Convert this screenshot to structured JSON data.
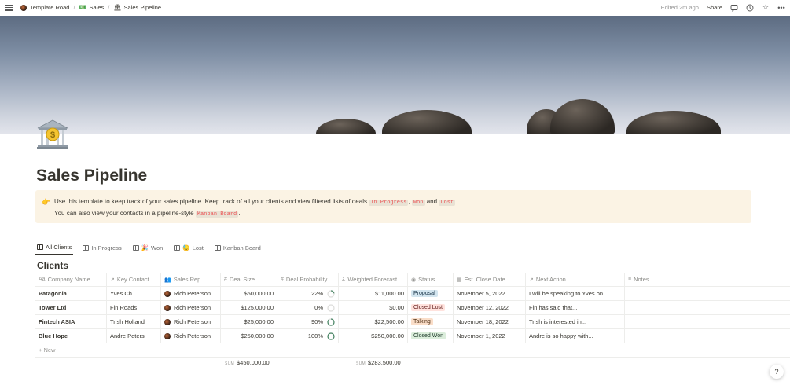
{
  "breadcrumb": [
    {
      "label": "Template Road",
      "icon": "avatar"
    },
    {
      "label": "Sales",
      "icon": "money-icon"
    },
    {
      "label": "Sales Pipeline",
      "icon": "bank-icon"
    }
  ],
  "topbar": {
    "edited": "Edited 2m ago",
    "share": "Share"
  },
  "page": {
    "title": "Sales Pipeline"
  },
  "callout": {
    "line1_a": "Use this template to keep track of your sales pipeline. Keep track of all your clients and view filtered lists of deals ",
    "tag_in_progress": "In Progress",
    "comma": ",",
    "tag_won": "Won",
    "and": " and ",
    "tag_lost": "Lost",
    "period": ".",
    "line2_a": "You can also view your contacts in a pipeline-style ",
    "tag_kanban": "Kanban Board",
    "line2_end": "."
  },
  "tabs": [
    {
      "label": "All Clients",
      "emoji": ""
    },
    {
      "label": "In Progress",
      "emoji": ""
    },
    {
      "label": "Won",
      "emoji": "🎉"
    },
    {
      "label": "Lost",
      "emoji": "😓"
    },
    {
      "label": "Kanban Board",
      "emoji": ""
    }
  ],
  "database": {
    "title": "Clients",
    "columns": [
      "Company Name",
      "Key Contact",
      "Sales Rep.",
      "Deal Size",
      "Deal Probability",
      "Weighted Forecast",
      "Status",
      "Est. Close Date",
      "Next Action",
      "Notes"
    ],
    "column_icons": [
      "Aa",
      "↗",
      "👥",
      "#",
      "#",
      "Σ",
      "◉",
      "▦",
      "↗",
      "≡"
    ],
    "rows": [
      {
        "company": "Patagonia",
        "contact": "Yves Ch.",
        "rep": "Rich Peterson",
        "deal": "$50,000.00",
        "prob": "22%",
        "prob_value": 0.22,
        "forecast": "$11,000.00",
        "status": "Proposal",
        "status_color": "#d3e5ef",
        "status_text_color": "#183347",
        "close": "November 5, 2022",
        "action": "I will be speaking to Yves on...",
        "notes": ""
      },
      {
        "company": "Tower Ltd",
        "contact": "Fin Roads",
        "rep": "Rich Peterson",
        "deal": "$125,000.00",
        "prob": "0%",
        "prob_value": 0,
        "forecast": "$0.00",
        "status": "Closed Lost",
        "status_color": "#ffe2dd",
        "status_text_color": "#5d1715",
        "close": "November 12, 2022",
        "action": "Fin has said that...",
        "notes": ""
      },
      {
        "company": "Fintech ASIA",
        "contact": "Trish Holland",
        "rep": "Rich Peterson",
        "deal": "$25,000.00",
        "prob": "90%",
        "prob_value": 0.9,
        "forecast": "$22,500.00",
        "status": "Talking",
        "status_color": "#fadec9",
        "status_text_color": "#49290e",
        "close": "November 18, 2022",
        "action": "Trish is interested in...",
        "notes": ""
      },
      {
        "company": "Blue Hope",
        "contact": "Andre Peters",
        "rep": "Rich Peterson",
        "deal": "$250,000.00",
        "prob": "100%",
        "prob_value": 1,
        "forecast": "$250,000.00",
        "status": "Closed Won",
        "status_color": "#dbeddb",
        "status_text_color": "#1c3829",
        "close": "November 1, 2022",
        "action": "Andre is so happy with...",
        "notes": ""
      }
    ],
    "new_label": "+ New",
    "sum_label": "SUM",
    "sum_deal": "$450,000.00",
    "sum_forecast": "$283,500.00"
  },
  "help_label": "?"
}
